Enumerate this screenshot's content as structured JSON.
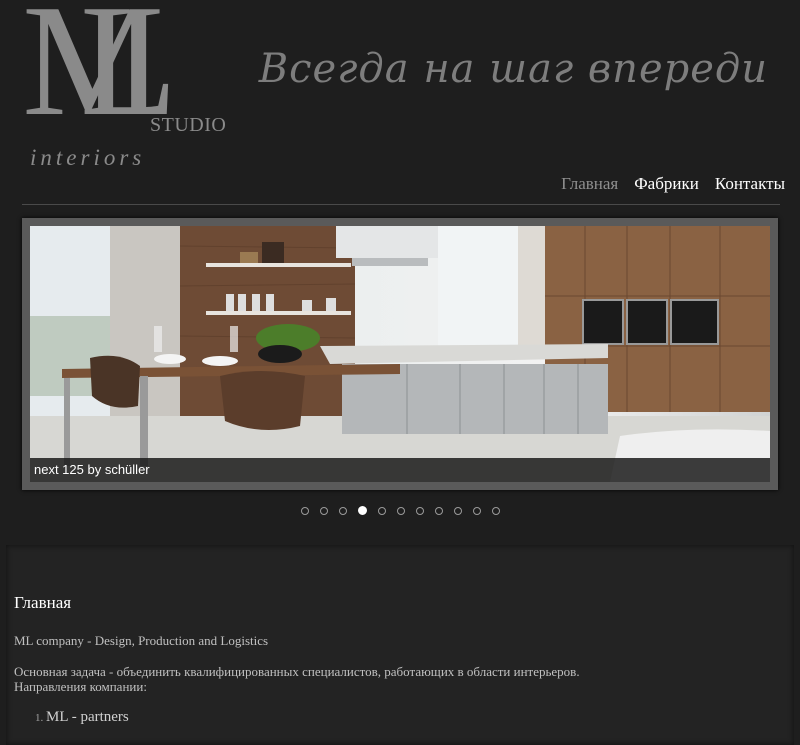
{
  "header": {
    "logo": {
      "letter_m": "M",
      "letter_l": "L",
      "studio": "STUDIO",
      "interiors": "interiors"
    },
    "slogan": "Всегда на шаг впереди"
  },
  "nav": {
    "items": [
      {
        "label": "Главная",
        "active": true
      },
      {
        "label": "Фабрики",
        "active": false
      },
      {
        "label": "Контакты",
        "active": false
      }
    ]
  },
  "slider": {
    "caption": "next 125 by schüller",
    "dot_count": 11,
    "active_index": 3
  },
  "content": {
    "title": "Главная",
    "paragraph1": "ML company - Design, Production and Logistics",
    "paragraph2_line1": "Основная задача - объединить квалифицированных специалистов, работающих в области интерьеров.",
    "paragraph2_line2": "Направления компании:",
    "list": [
      "ML - partners"
    ]
  },
  "colors": {
    "background": "#1e1e1e",
    "nav_active": "#8f8f8f",
    "nav_link": "#ffffff",
    "logo_gray": "#8a8a8a"
  }
}
